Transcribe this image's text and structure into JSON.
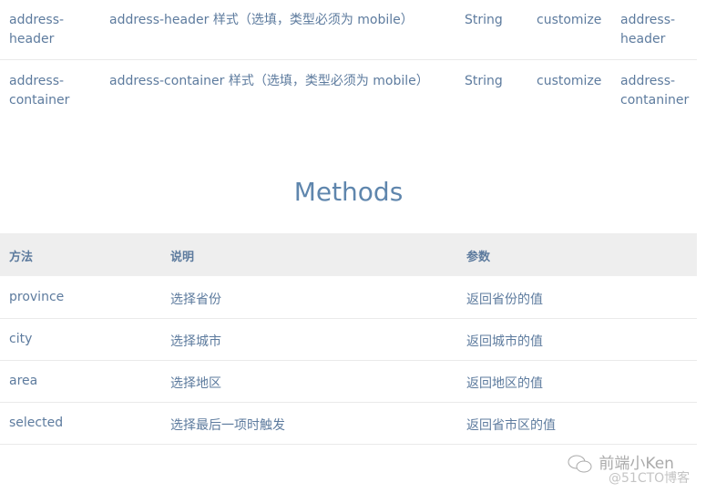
{
  "props": [
    {
      "name": "address-header",
      "desc": "address-header 样式（选填，类型必须为 mobile）",
      "type": "String",
      "option": "customize",
      "default": "address-header"
    },
    {
      "name": "address-container",
      "desc": "address-container 样式（选填，类型必须为 mobile）",
      "type": "String",
      "option": "customize",
      "default": "address-contaniner"
    }
  ],
  "methods": {
    "title": "Methods",
    "headers": [
      "方法",
      "说明",
      "参数"
    ],
    "rows": [
      [
        "province",
        "选择省份",
        "返回省份的值"
      ],
      [
        "city",
        "选择城市",
        "返回城市的值"
      ],
      [
        "area",
        "选择地区",
        "返回地区的值"
      ],
      [
        "selected",
        "选择最后一项时触发",
        "返回省市区的值"
      ]
    ]
  },
  "watermark": {
    "account": "前端小Ken",
    "site": "@51CTO博客",
    "icon": "wechat-icon"
  }
}
